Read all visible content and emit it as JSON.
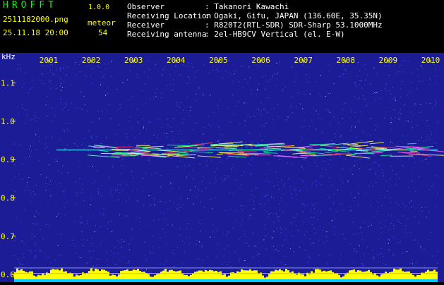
{
  "app": {
    "title": "HROFFT",
    "version": "1.0.0"
  },
  "file": {
    "name": "2511182000.png",
    "datetime": "25.11.18 20:00"
  },
  "meteor": {
    "label": "meteor",
    "count": "54"
  },
  "info": [
    {
      "key": "Observer",
      "value": ": Takanori Kawachi"
    },
    {
      "key": "Receiving Location",
      "value": ": Ogaki, Gifu, JAPAN (136.60E, 35.35N)"
    },
    {
      "key": "Receiver",
      "value": ": R820T2(RTL-SDR) SDR-Sharp 53.1000MHz"
    },
    {
      "key": "Receiving antenna",
      "value": ": 2el-HB9CV Vertical (el. E-W)"
    }
  ],
  "spectrogram": {
    "unit_label": "kHz",
    "time_ticks": [
      "2001",
      "2002",
      "2003",
      "2004",
      "2005",
      "2006",
      "2007",
      "2008",
      "2009",
      "2010"
    ],
    "freq_ticks": [
      "1.1",
      "1.0",
      "0.9",
      "0.8",
      "0.7",
      "0.6"
    ],
    "freq_range": [
      0.58,
      1.16
    ],
    "colors": {
      "background": "#1c1c96",
      "noise": "#3a5aff",
      "tick_label": "#ffff00",
      "axis_label": "#ffffff",
      "carrier": "#4fd8ff",
      "level_bar": "#ffff00",
      "level_base": "#00c8ff"
    },
    "carrier_freq": 0.925,
    "reference_lines": [
      0.617,
      0.603
    ]
  }
}
